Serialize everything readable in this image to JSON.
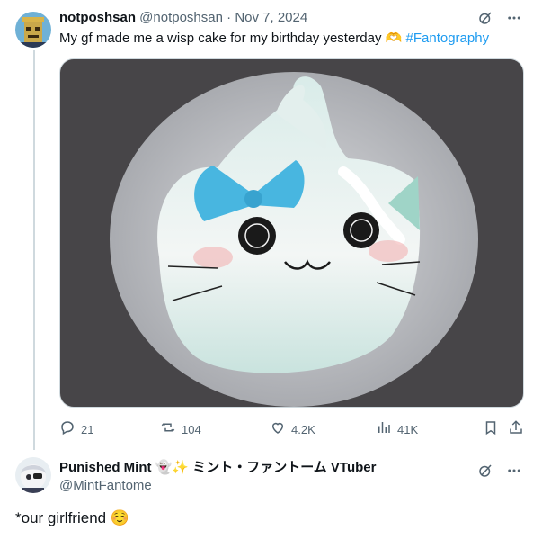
{
  "tweet": {
    "author_name": "notposhsan",
    "author_handle": "@notposhsan",
    "separator": "·",
    "date": "Nov 7, 2024",
    "text": "My gf made me a wisp cake for my birthday yesterday",
    "emoji": "🫶",
    "hashtag": "#Fantography",
    "image_alt": "Cake shaped like a wisp ghost with blue bow",
    "stats": {
      "replies": "21",
      "retweets": "104",
      "likes": "4.2K",
      "views": "41K"
    }
  },
  "reply": {
    "author_name": "Punished Mint",
    "name_emojis": "👻✨",
    "name_suffix": "ミント・ファントーム VTuber",
    "author_handle": "@MintFantome",
    "text": "*our girlfriend",
    "text_emoji": "☺️"
  },
  "icons": {
    "grok": "grok-icon",
    "more": "more-icon",
    "reply": "reply-icon",
    "retweet": "retweet-icon",
    "like": "heart-icon",
    "views": "views-icon",
    "bookmark": "bookmark-icon",
    "share": "share-icon"
  },
  "colors": {
    "accent": "#1d9bf0",
    "muted": "#536471",
    "text": "#0f1419",
    "line": "#cfd9de"
  }
}
